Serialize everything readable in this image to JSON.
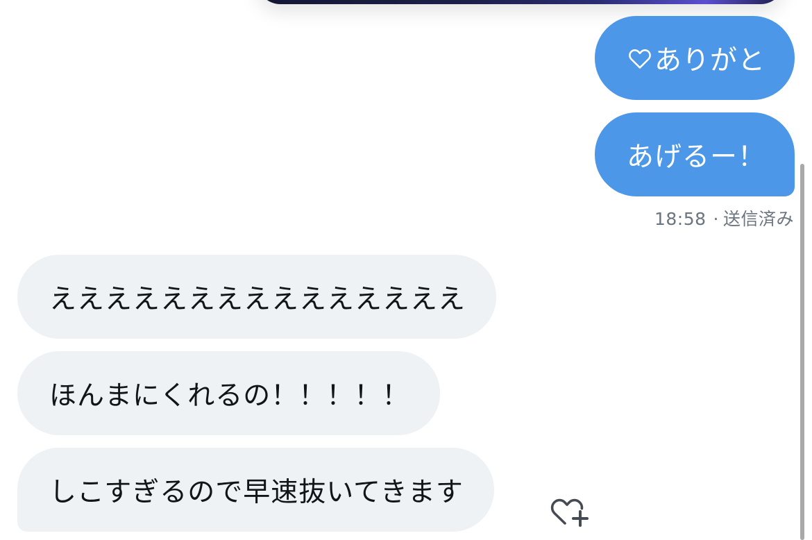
{
  "conversation": {
    "sent_messages": [
      {
        "text": "ありがと",
        "icon": "heart-outline-icon"
      },
      {
        "text": "あげるー！"
      }
    ],
    "sent_meta": {
      "time": "18:58",
      "separator": "·",
      "status": "送信済み"
    },
    "received_messages": [
      {
        "text": "えええええええええええええええ"
      },
      {
        "text": "ほんまにくれるの！！！！！"
      },
      {
        "text": "しこすぎるので早速抜いてきます"
      }
    ],
    "reaction_icon": "add-reaction-heart-icon"
  },
  "colors": {
    "sent_bubble": "#4c97e7",
    "received_bubble": "#eff2f4",
    "meta_text": "#6b7580"
  }
}
